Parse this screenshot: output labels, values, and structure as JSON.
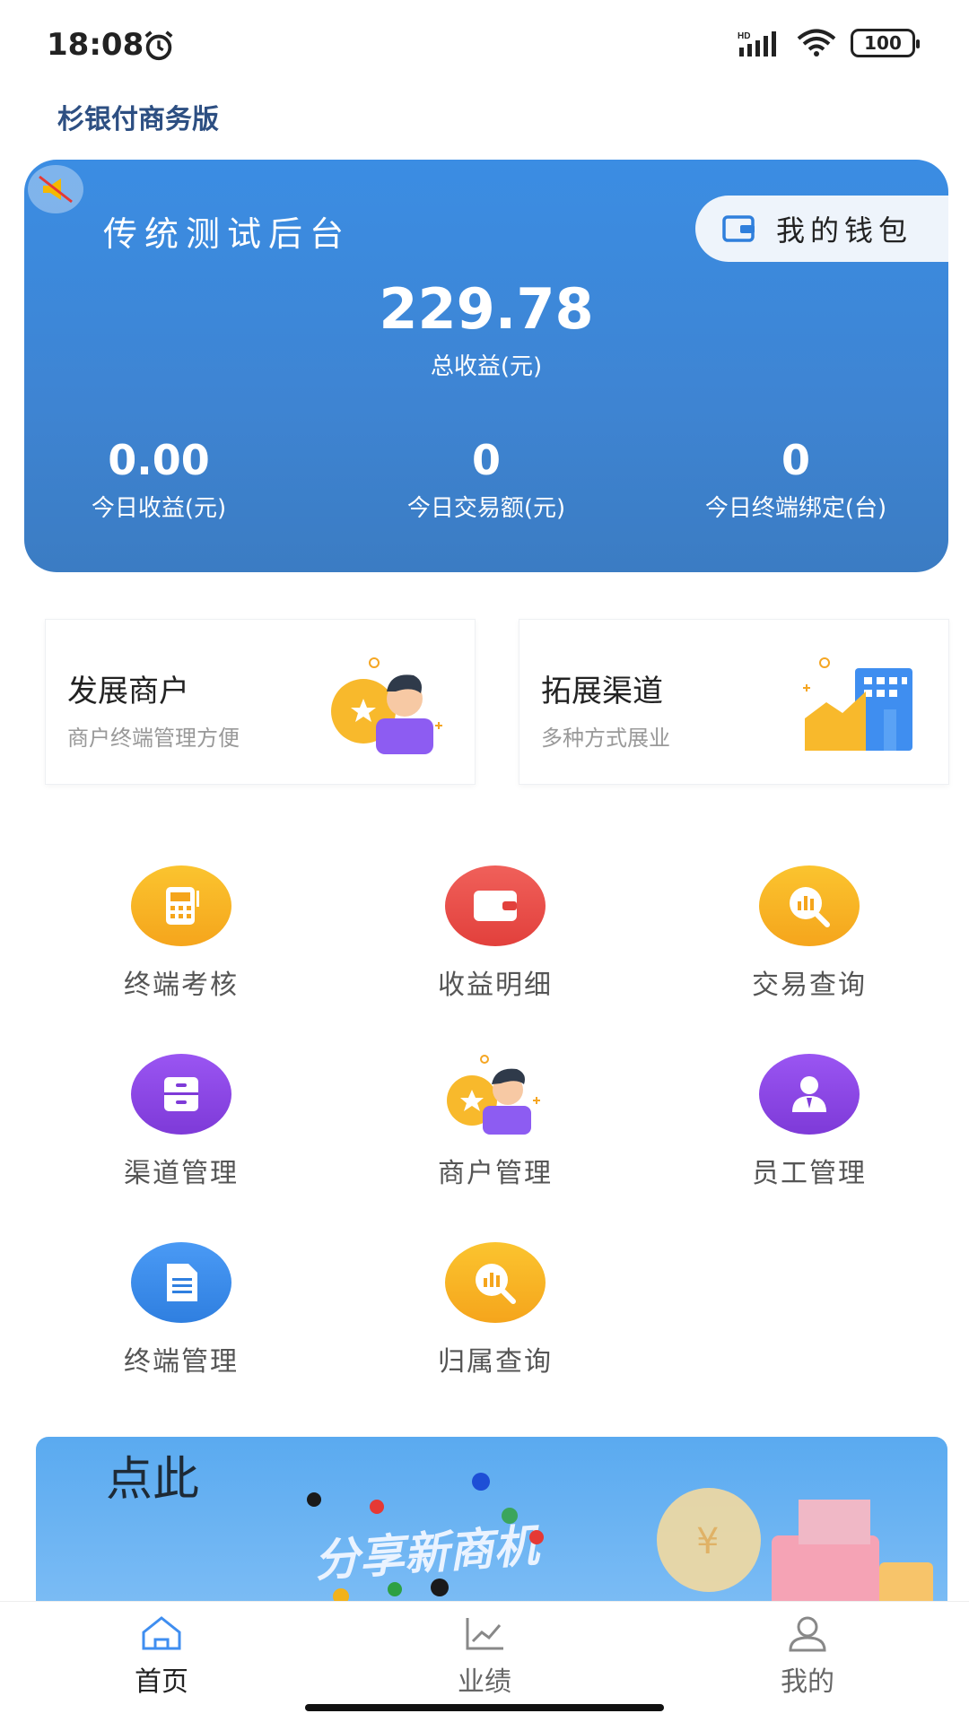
{
  "status_bar": {
    "time": "18:08",
    "battery": "100"
  },
  "app": {
    "title": "杉银付商务版"
  },
  "hero": {
    "name": "传统测试后台",
    "wallet_label": "我的钱包",
    "total_value": "229.78",
    "total_label": "总收益(元)",
    "stats": [
      {
        "value": "0.00",
        "label": "今日收益(元)"
      },
      {
        "value": "0",
        "label": "今日交易额(元)"
      },
      {
        "value": "0",
        "label": "今日终端绑定(台)"
      }
    ]
  },
  "features": [
    {
      "title": "发展商户",
      "subtitle": "商户终端管理方便"
    },
    {
      "title": "拓展渠道",
      "subtitle": "多种方式展业"
    }
  ],
  "grid": [
    {
      "label": "终端考核",
      "icon": "pos-terminal-icon",
      "color": "#f7b52a"
    },
    {
      "label": "收益明细",
      "icon": "wallet-icon",
      "color": "#ef5350"
    },
    {
      "label": "交易查询",
      "icon": "chart-search-icon",
      "color": "#f7b52a"
    },
    {
      "label": "渠道管理",
      "icon": "drawer-icon",
      "color": "#8e44e8"
    },
    {
      "label": "商户管理",
      "icon": "merchant-icon",
      "color": "#f7b52a"
    },
    {
      "label": "员工管理",
      "icon": "employee-icon",
      "color": "#8e44e8"
    },
    {
      "label": "终端管理",
      "icon": "document-icon",
      "color": "#3f8ef0"
    },
    {
      "label": "归属查询",
      "icon": "chart-search-icon",
      "color": "#f7b52a"
    }
  ],
  "banner": {
    "main_text": "分享新商机",
    "side_text": "点此"
  },
  "tabs": [
    {
      "label": "首页",
      "icon": "home-icon",
      "active": true
    },
    {
      "label": "业绩",
      "icon": "trend-icon",
      "active": false
    },
    {
      "label": "我的",
      "icon": "profile-icon",
      "active": false
    }
  ],
  "colors": {
    "primary": "#3b8de3",
    "active_tab": "#222222",
    "inactive_tab": "#666666"
  }
}
